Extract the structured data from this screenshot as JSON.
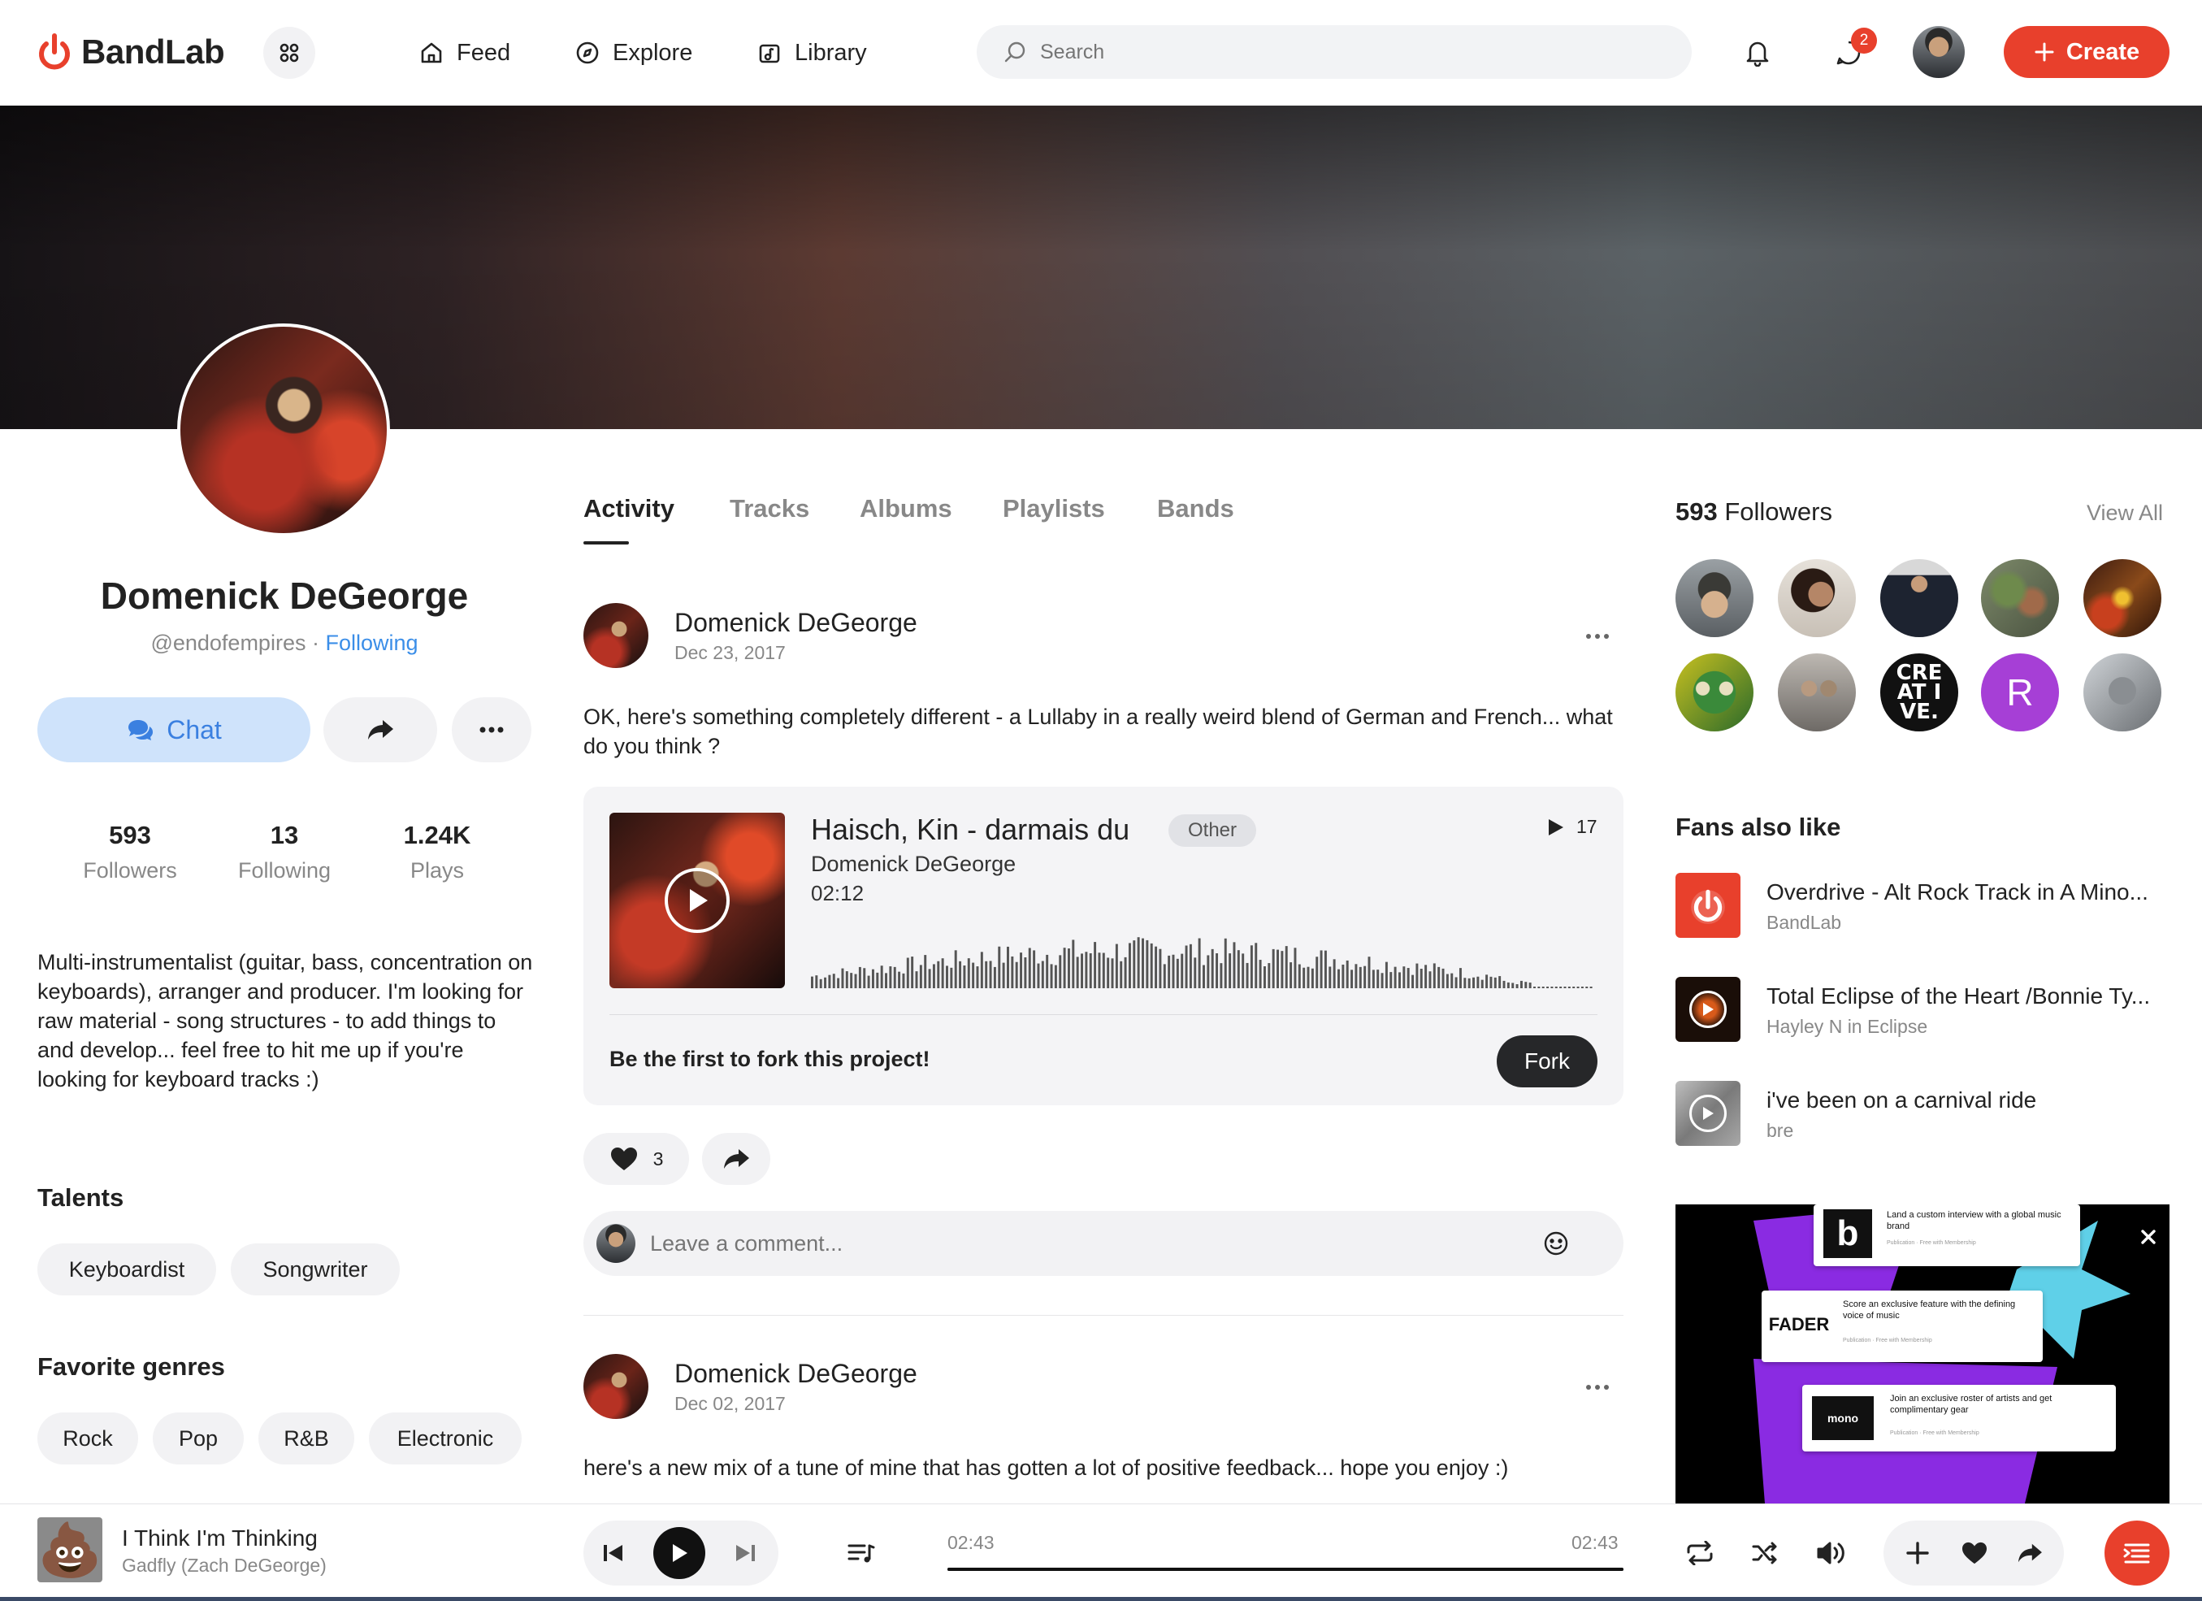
{
  "nav": {
    "brand": "BandLab",
    "links": [
      {
        "label": "Feed"
      },
      {
        "label": "Explore"
      },
      {
        "label": "Library"
      }
    ],
    "search_placeholder": "Search",
    "messages_badge": "2",
    "create_label": "Create"
  },
  "profile": {
    "name": "Domenick DeGeorge",
    "handle": "@endofempires",
    "separator": " · ",
    "follow_status": "Following",
    "chat_label": "Chat",
    "stats": [
      {
        "value": "593",
        "label": "Followers"
      },
      {
        "value": "13",
        "label": "Following"
      },
      {
        "value": "1.24K",
        "label": "Plays"
      }
    ],
    "bio": "Multi-instrumentalist (guitar, bass, concentration on keyboards), arranger and producer. I'm looking for raw material - song structures - to add things to and develop... feel free to hit me up if you're looking for keyboard tracks :)",
    "talents_heading": "Talents",
    "talents": [
      "Keyboardist",
      "Songwriter"
    ],
    "genres_heading": "Favorite genres",
    "genres": [
      "Rock",
      "Pop",
      "R&B",
      "Electronic"
    ]
  },
  "tabs": [
    {
      "label": "Activity",
      "active": true
    },
    {
      "label": "Tracks"
    },
    {
      "label": "Albums"
    },
    {
      "label": "Playlists"
    },
    {
      "label": "Bands"
    }
  ],
  "posts": [
    {
      "author": "Domenick DeGeorge",
      "date": "Dec 23, 2017",
      "text": "OK, here's something completely different - a Lullaby in a really weird blend of German and French... what do you think ?",
      "track": {
        "title": "Haisch, Kin - darmais du",
        "genre": "Other",
        "artist": "Domenick DeGeorge",
        "duration": "02:12",
        "plays": "17"
      },
      "fork_prompt": "Be the first to fork this project!",
      "fork_label": "Fork",
      "likes": "3"
    },
    {
      "author": "Domenick DeGeorge",
      "date": "Dec 02, 2017",
      "text": "here's a new mix of a tune of mine that has gotten a lot of positive feedback... hope you enjoy :)"
    }
  ],
  "comment_placeholder": "Leave a comment...",
  "followers": {
    "count": "593",
    "label": " Followers",
    "view_all": "View All",
    "initial_avatar_letter": "R",
    "text_avatar": "CRE AT I VE."
  },
  "fans_also_like": {
    "heading": "Fans also like",
    "items": [
      {
        "title": "Overdrive - Alt Rock Track in A Mino...",
        "subtitle": "BandLab"
      },
      {
        "title": "Total Eclipse of the Heart /Bonnie Ty...",
        "subtitle": "Hayley N in Eclipse"
      },
      {
        "title": "i've been on a carnival ride",
        "subtitle": "bre"
      }
    ]
  },
  "ad": {
    "cards": [
      {
        "logo": "b",
        "text": "Land a custom interview with a global music brand",
        "meta": "Publication · Free with Membership"
      },
      {
        "logo": "FADER",
        "text": "Score an exclusive feature with the defining voice of music",
        "meta": "Publication · Free with Membership"
      },
      {
        "logo": "mono",
        "text": "Join an exclusive roster of artists and get complimentary gear",
        "meta": "Publication · Free with Membership"
      }
    ]
  },
  "player": {
    "title": "I Think I'm Thinking",
    "artist": "Gadfly (Zach DeGeorge)",
    "time_current": "02:43",
    "time_total": "02:43",
    "progress": 1.0
  },
  "colors": {
    "accent": "#e8402c",
    "link": "#3b8ee8",
    "chat_bg": "#cfe3fb",
    "purple_avatar": "#a63fd6"
  }
}
